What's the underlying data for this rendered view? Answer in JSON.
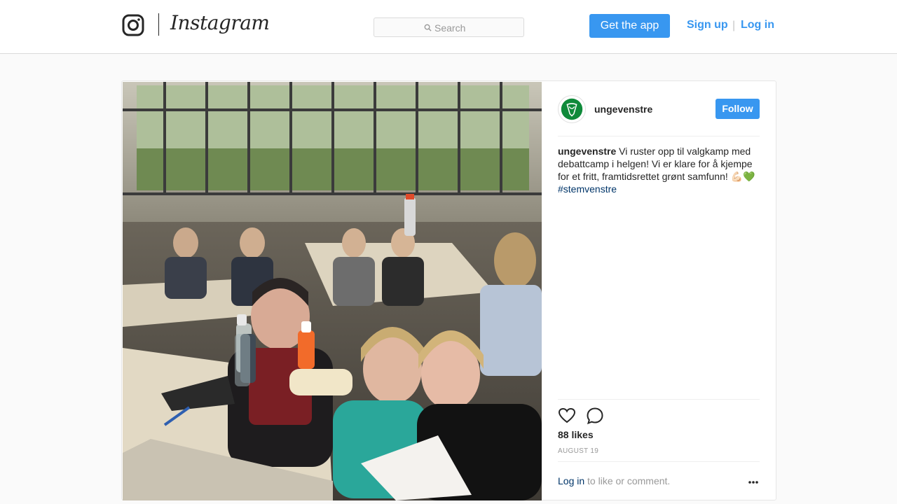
{
  "nav": {
    "wordmark": "Instagram",
    "search_placeholder": "Search",
    "get_app_label": "Get the app",
    "signup_label": "Sign up",
    "separator": "|",
    "login_label": "Log in",
    "accent_color": "#3897f0"
  },
  "post": {
    "username": "ungevenstre",
    "follow_label": "Follow",
    "caption": {
      "username": "ungevenstre",
      "text": "Vi ruster opp til valgkamp med debattcamp i helgen! Vi er klare for å kjempe for et fritt, framtidsrettet grønt samfunn! 💪🏻💚",
      "hashtag": "#stemvenstre"
    },
    "likes": "88 likes",
    "date": "AUGUST 19",
    "login_prompt": {
      "link": "Log in",
      "rest": " to like or comment."
    },
    "icons": [
      "heart-icon",
      "comment-icon",
      "more-icon",
      "instagram-glyph-icon",
      "search-icon"
    ]
  }
}
